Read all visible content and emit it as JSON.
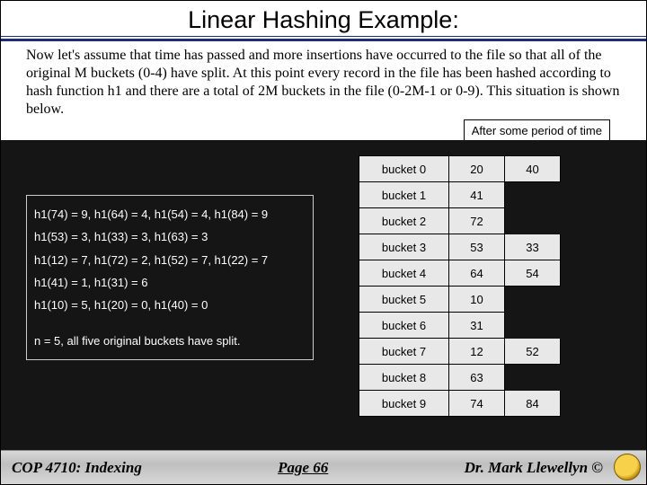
{
  "title": "Linear Hashing Example:",
  "paragraph": "Now let's assume that time has passed and more insertions have occurred to the file so that all of the original M buckets (0-4) have split.  At this point every record in the file has been hashed according to hash function h1 and there are a total of 2M buckets in the file (0-2M-1 or 0-9).  This situation is shown below.",
  "caption": "After some period of time",
  "hash_lines": [
    "h1(74) = 9, h1(64) = 4, h1(54) = 4, h1(84) = 9",
    "h1(53) = 3, h1(33) = 3, h1(63) = 3",
    "h1(12) = 7, h1(72) = 2, h1(52) = 7, h1(22) = 7",
    "h1(41) = 1, h1(31) = 6",
    "h1(10) = 5, h1(20) = 0, h1(40) = 0"
  ],
  "hash_note": "n = 5, all five original buckets have split.",
  "buckets": [
    {
      "label": "bucket 0",
      "v1": "20",
      "v2": "40"
    },
    {
      "label": "bucket 1",
      "v1": "41",
      "v2": ""
    },
    {
      "label": "bucket 2",
      "v1": "72",
      "v2": ""
    },
    {
      "label": "bucket 3",
      "v1": "53",
      "v2": "33"
    },
    {
      "label": "bucket 4",
      "v1": "64",
      "v2": "54"
    },
    {
      "label": "bucket 5",
      "v1": "10",
      "v2": ""
    },
    {
      "label": "bucket 6",
      "v1": "31",
      "v2": ""
    },
    {
      "label": "bucket 7",
      "v1": "12",
      "v2": "52"
    },
    {
      "label": "bucket 8",
      "v1": "63",
      "v2": ""
    },
    {
      "label": "bucket 9",
      "v1": "74",
      "v2": "84"
    }
  ],
  "footer": {
    "left": "COP 4710: Indexing",
    "center": "Page 66",
    "right": "Dr. Mark Llewellyn ©"
  }
}
